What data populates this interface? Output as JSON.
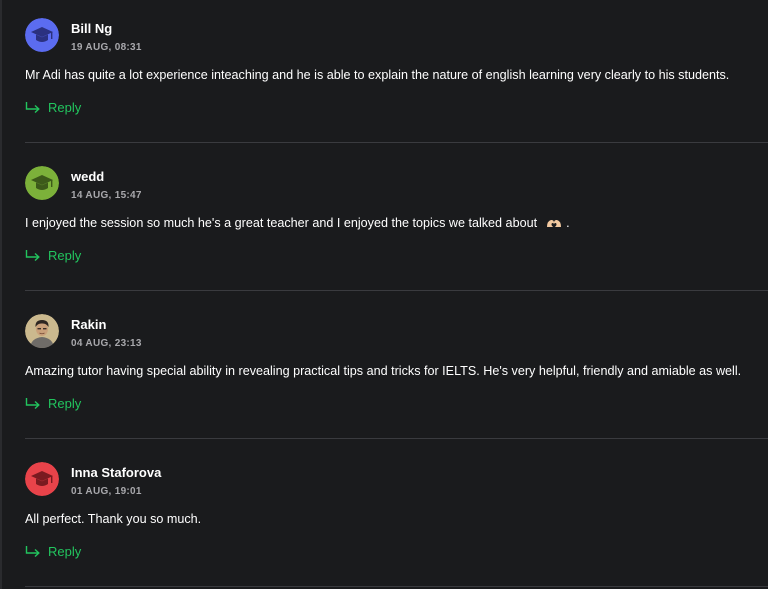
{
  "reviews": [
    {
      "name": "Bill Ng",
      "date": "19 AUG, 08:31",
      "text": "Mr Adi has quite a lot experience inteaching and he is able to explain the nature of english learning very clearly to his students.",
      "reply_label": "Reply",
      "avatar": {
        "icon": "graduation-cap-icon",
        "color": "#5b6cf0"
      }
    },
    {
      "name": "wedd",
      "date": "14 AUG, 15:47",
      "text": "I enjoyed the session so much he's a great teacher and I enjoyed the topics we talked about",
      "text_suffix": ".",
      "emoji": "heart-hands-icon",
      "reply_label": "Reply",
      "avatar": {
        "icon": "graduation-cap-icon",
        "color": "#7cb13a"
      }
    },
    {
      "name": "Rakin",
      "date": "04 AUG, 23:13",
      "text": "Amazing tutor having special ability in revealing practical tips and tricks for IELTS. He's very helpful, friendly and amiable as well.",
      "reply_label": "Reply",
      "avatar": {
        "icon": "user-photo",
        "color": "#cbb98e"
      }
    },
    {
      "name": "Inna Staforova",
      "date": "01 AUG, 19:01",
      "text": "All perfect. Thank you so much.",
      "reply_label": "Reply",
      "avatar": {
        "icon": "graduation-cap-icon",
        "color": "#e8434a"
      }
    }
  ],
  "colors": {
    "background": "#1a1b1d",
    "reply": "#22c55e",
    "date": "#a8a8ac",
    "divider": "#3a3b3f"
  }
}
